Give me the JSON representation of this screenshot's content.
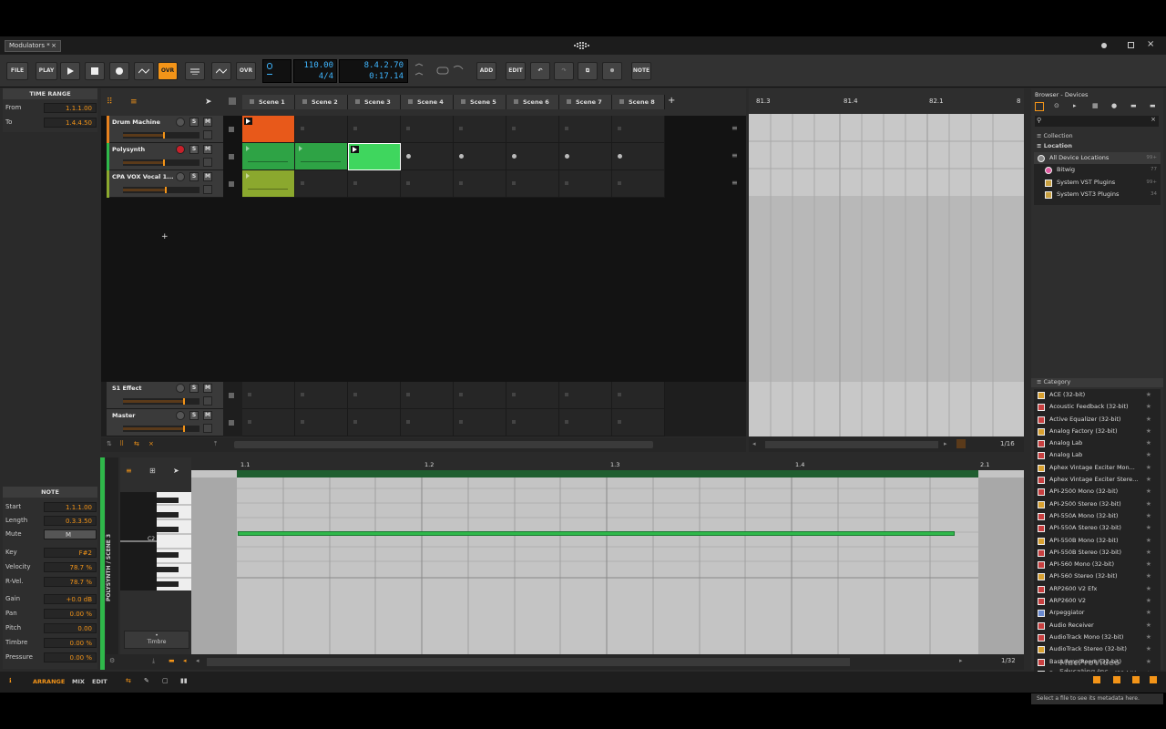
{
  "window": {
    "tab_title": "Modulators *",
    "close": "×"
  },
  "toolbar": {
    "file": "FILE",
    "play_menu": "PLAY",
    "ovr1": "OVR",
    "ovr2": "OVR",
    "ovr3": "OVR",
    "tempo": "110.00",
    "signature": "4/4",
    "position": "8.4.2.70",
    "time": "0:17.14",
    "add": "ADD",
    "edit": "EDIT",
    "note": "NOTE"
  },
  "time_range": {
    "title": "TIME RANGE",
    "from_label": "From",
    "from_value": "1.1.1.00",
    "to_label": "To",
    "to_value": "1.4.4.50"
  },
  "note_panel": {
    "title": "NOTE",
    "fields": [
      {
        "label": "Start",
        "value": "1.1.1.00"
      },
      {
        "label": "Length",
        "value": "0.3.3.50"
      },
      {
        "label": "Mute",
        "value": "M"
      },
      {
        "label": "Key",
        "value": "F#2"
      },
      {
        "label": "Velocity",
        "value": "78.7 %"
      },
      {
        "label": "R-Vel.",
        "value": "78.7 %"
      },
      {
        "label": "Gain",
        "value": "+0.0 dB"
      },
      {
        "label": "Pan",
        "value": "0.00 %"
      },
      {
        "label": "Pitch",
        "value": "0.00"
      },
      {
        "label": "Timbre",
        "value": "0.00 %"
      },
      {
        "label": "Pressure",
        "value": "0.00 %"
      }
    ]
  },
  "tracks": [
    {
      "name": "Drum Machine",
      "color": "#e8821e"
    },
    {
      "name": "Polysynth",
      "color": "#2fb84a"
    },
    {
      "name": "CPA VOX Vocal 1...",
      "color": "#8ba82e"
    }
  ],
  "fx_tracks": [
    {
      "name": "S1 Effect"
    },
    {
      "name": "Master"
    }
  ],
  "track_buttons": {
    "s": "S",
    "m": "M"
  },
  "scenes": [
    "Scene 1",
    "Scene 2",
    "Scene 3",
    "Scene 4",
    "Scene 5",
    "Scene 6",
    "Scene 7",
    "Scene 8"
  ],
  "scene_add": "+",
  "arranger_ruler": [
    "81.3",
    "81.4",
    "82.1",
    "8"
  ],
  "arranger_zoom": "1/16",
  "editor": {
    "ruler": [
      "1.1",
      "1.2",
      "1.3",
      "1.4",
      "2.1"
    ],
    "vertical_label": "POLYSYNTH / SCENE 3",
    "key_label": "C2",
    "expression": "Timbre",
    "zoom": "1/32"
  },
  "browser": {
    "title": "Browser - Devices",
    "collection": "Collection",
    "location": "Location",
    "locations": [
      {
        "name": "All Device Locations",
        "count": "99+"
      },
      {
        "name": "Bitwig",
        "count": "77"
      },
      {
        "name": "System VST Plugins",
        "count": "99+"
      },
      {
        "name": "System VST3 Plugins",
        "count": "34"
      }
    ],
    "category": "Category",
    "items": [
      "ACE (32-bit)",
      "Acoustic Feedback (32-bit)",
      "Active Equalizer (32-bit)",
      "Analog Factory (32-bit)",
      "Analog Lab",
      "Analog Lab",
      "Aphex Vintage Exciter Mon...",
      "Aphex Vintage Exciter Stere...",
      "API-2500 Mono (32-bit)",
      "API-2500 Stereo (32-bit)",
      "API-550A Mono (32-bit)",
      "API-550A Stereo (32-bit)",
      "API-550B Mono (32-bit)",
      "API-550B Stereo (32-bit)",
      "API-560 Mono (32-bit)",
      "API-560 Stereo (32-bit)",
      "ARP2600 V2 Efx",
      "ARP2600 V2",
      "Arpeggiator",
      "Audio Receiver",
      "AudioTrack Mono (32-bit)",
      "AudioTrack Stereo (32-bit)",
      "Bass Amp Room (32-bit)",
      "Bass Rider Live Mono (32-bit)",
      "Bass Rider Live Stereo (32-..."
    ],
    "footer": "Select a file to see its metadata here.",
    "watermark_line1": "MacProVideo",
    "watermark_line2": "Educating Inc."
  },
  "bottom": {
    "arrange": "ARRANGE",
    "mix": "MIX",
    "edit": "EDIT"
  },
  "colors": {
    "accent": "#f39418",
    "green": "#2fb84a",
    "orange_clip": "#e8591a",
    "lime_clip": "#8ba82e"
  }
}
